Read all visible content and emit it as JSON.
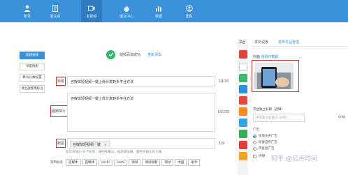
{
  "nav": {
    "items": [
      {
        "label": "账号",
        "icon": "user-icon"
      },
      {
        "label": "发文章",
        "icon": "document-icon"
      },
      {
        "label": "发视频",
        "icon": "video-icon"
      },
      {
        "label": "爆文中心",
        "icon": "flame-icon"
      },
      {
        "label": "数据",
        "icon": "chart-icon"
      },
      {
        "label": "团队",
        "icon": "team-icon"
      }
    ],
    "active_index": 2
  },
  "sidebar": {
    "buttons": [
      "新建视频",
      "深度搜索",
      "默认分类设置",
      "请全部使用标注"
    ]
  },
  "status": {
    "message": "视频添加成功",
    "relink": "重新添加"
  },
  "form": {
    "title_label": "标题",
    "title_value": "自媒体短视频一键上传分发到多平台方法",
    "title_count": "18/30",
    "intro_label": "视频简介",
    "intro_value": "自媒体短视频一键上传分发到多平台方法",
    "intro_count": "18/200",
    "tags_label": "标签",
    "tag_chip": "自媒体短视频一键",
    "tag_remove": "×",
    "tags_count": "1/9",
    "hint_pre": "您可添加",
    "hint_em": "2~9 个",
    "hint_post": "标签，按回车确认。描述越准确，越利于被认识人群。",
    "common_label": "常用标签",
    "common_tags": [
      "自媒体",
      "自媒体",
      "ceshi",
      "ceshi",
      "测试",
      "测试视频",
      "测试",
      "中国",
      "助手"
    ]
  },
  "right_panel": {
    "platform_label": "平台",
    "tabs": [
      "发布设置",
      "发布平台管理"
    ],
    "cover_label": "封面",
    "cover_link": "视频中截取",
    "standalone_label": "平台独立标题（选填）",
    "standalone_placeholder": "平台独立标题(5-30字)",
    "standalone_count": "0/30",
    "ad_label": "广告",
    "ad_options": [
      "投放头条广告",
      "投放自有广告",
      "不投放广告"
    ],
    "ad_selected": 0,
    "original_label": "声明"
  },
  "watermark": "知乎 @亿点时间",
  "colors": {
    "topbar": "#3a90d9",
    "accent": "#3a90d9",
    "highlight": "#d9342b",
    "success": "#2fb567"
  }
}
